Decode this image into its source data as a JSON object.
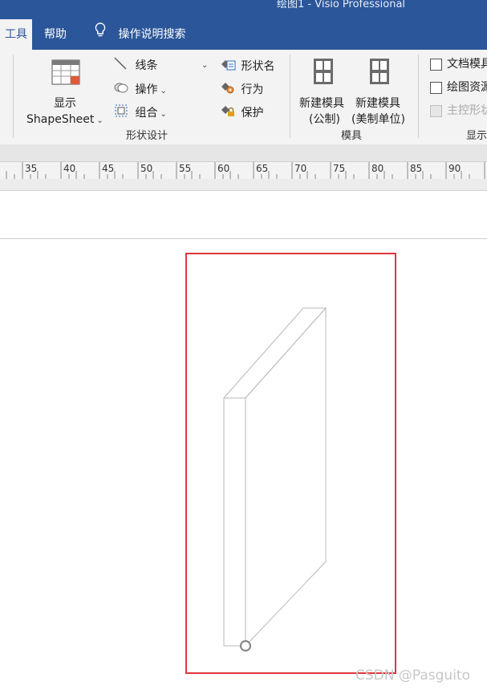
{
  "window": {
    "title": "绘图1  -  Visio Professional"
  },
  "tabs": [
    {
      "label": "工具",
      "active": true
    },
    {
      "label": "帮助",
      "active": false
    },
    {
      "label": "操作说明搜索",
      "active": false
    }
  ],
  "ribbon": {
    "show_shapesheet": {
      "line1": "显示",
      "line2": "ShapeSheet"
    },
    "shape_design": {
      "label": "形状设计",
      "line": "线条",
      "operation": "操作",
      "group": "组合",
      "shape_name": "形状名",
      "behavior": "行为",
      "protection": "保护"
    },
    "stencil": {
      "label": "模具",
      "new_metric": {
        "line1": "新建模具",
        "line2": "(公制)"
      },
      "new_us": {
        "line1": "新建模具",
        "line2": "(美制单位)"
      }
    },
    "show": {
      "label": "显示",
      "doc_stencil": "文档模具",
      "drawing_resources": "绘图资源",
      "master_shapes": "主控形状"
    }
  },
  "ruler": {
    "ticks": [
      "35",
      "40",
      "45",
      "50",
      "55",
      "60",
      "65",
      "70",
      "75",
      "80",
      "85",
      "90"
    ]
  },
  "colors": {
    "accent": "#2b579a",
    "selection": "#e0353b"
  },
  "watermark": "CSDN @Pasguito"
}
